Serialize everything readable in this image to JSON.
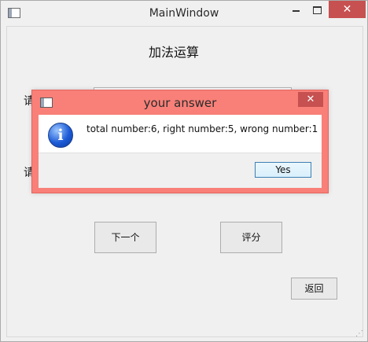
{
  "window": {
    "title": "MainWindow",
    "controls": {
      "minimize": "",
      "maximize": "",
      "close": "✕"
    }
  },
  "main": {
    "heading": "加法运算",
    "prompt1_visible": "请",
    "prompt2_visible": "请",
    "answer_field_value": "",
    "next_button": "下一个",
    "score_button": "评分",
    "back_button": "返回"
  },
  "dialog": {
    "title": "your answer",
    "close": "✕",
    "icon": "info-icon",
    "message": "total number:6, right number:5, wrong number:1",
    "yes_button": "Yes",
    "colors": {
      "frame": "#f88078",
      "close_bg": "#c75050",
      "yes_border": "#3c7fb1"
    }
  },
  "icons": {
    "app": "window-app-icon",
    "resize": "resize-grip-icon"
  }
}
